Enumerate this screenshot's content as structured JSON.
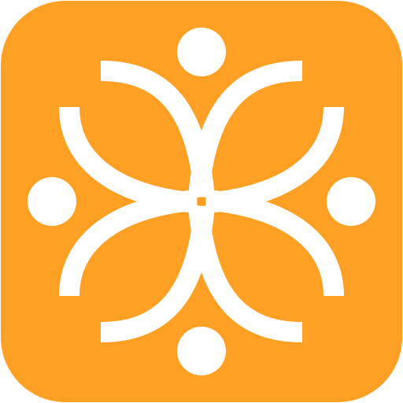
{
  "app_icon": {
    "icon": "flower-people-logo-icon",
    "background_color": "#FDA024",
    "foreground_color": "#FFFFFF"
  }
}
